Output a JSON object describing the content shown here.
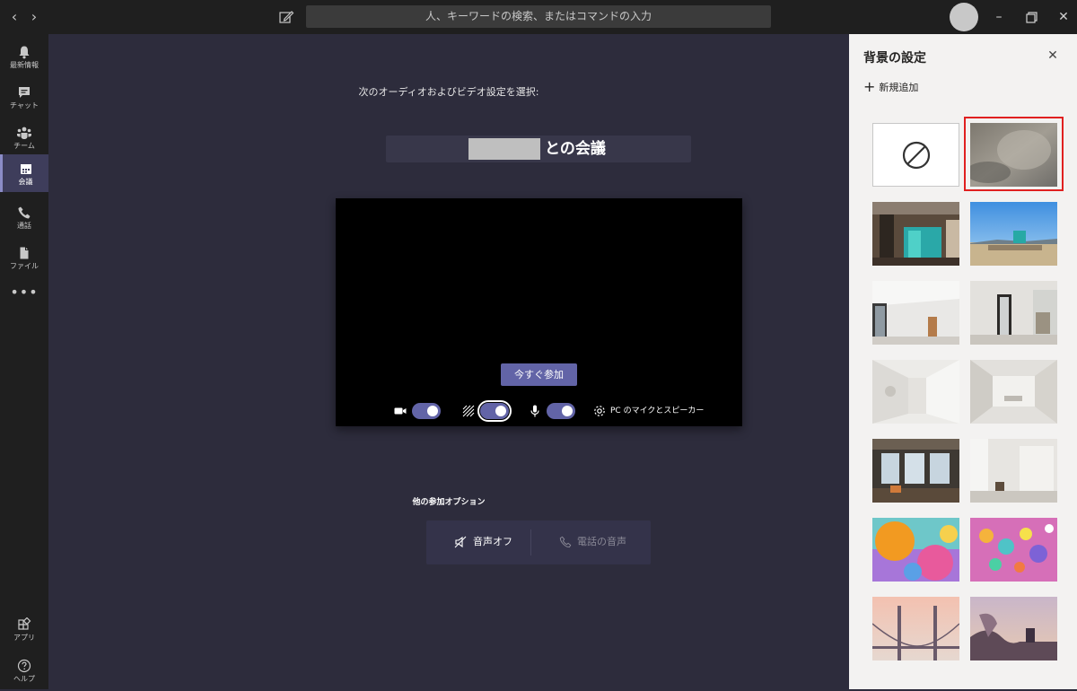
{
  "titlebar": {
    "search_placeholder": "人、キーワードの検索、またはコマンドの入力",
    "icons": [
      "back-arrow-icon",
      "forward-arrow-icon",
      "compose-icon",
      "minimize-icon",
      "maximize-icon",
      "close-icon"
    ]
  },
  "rail": {
    "items": [
      {
        "label": "最新情報",
        "icon": "bell-icon"
      },
      {
        "label": "チャット",
        "icon": "chat-icon"
      },
      {
        "label": "チーム",
        "icon": "teams-icon"
      },
      {
        "label": "会議",
        "icon": "calendar-icon",
        "active": true
      },
      {
        "label": "通話",
        "icon": "phone-icon"
      },
      {
        "label": "ファイル",
        "icon": "file-icon"
      }
    ],
    "more": "•••",
    "bottom": [
      {
        "label": "アプリ",
        "icon": "apps-icon"
      },
      {
        "label": "ヘルプ",
        "icon": "help-icon"
      }
    ]
  },
  "meeting": {
    "prompt": "次のオーディオおよびビデオ設定を選択:",
    "title_suffix": "との会議",
    "join_button": "今すぐ参加",
    "device_label": "PC のマイクとスピーカー",
    "video_on": true,
    "blur_on": true,
    "mic_on": true,
    "other_options_title": "他の参加オプション",
    "audio_off": "音声オフ",
    "phone_audio": "電話の音声"
  },
  "background_panel": {
    "title": "背景の設定",
    "add_new": "新規追加",
    "selected_index": 1,
    "thumbnails": [
      "none",
      "blur",
      "office-loft",
      "beach",
      "white-room-1",
      "white-room-2",
      "white-arch-1",
      "white-arch-2",
      "office-windows",
      "white-studio",
      "balloons-orange",
      "balloons-pink",
      "bridge-sunset",
      "fantasy-landscape"
    ]
  },
  "colors": {
    "accent": "#6264a7",
    "rail_bg": "#1f1f1f",
    "stage_bg": "#2d2c3c",
    "selected_border": "#e02020"
  }
}
